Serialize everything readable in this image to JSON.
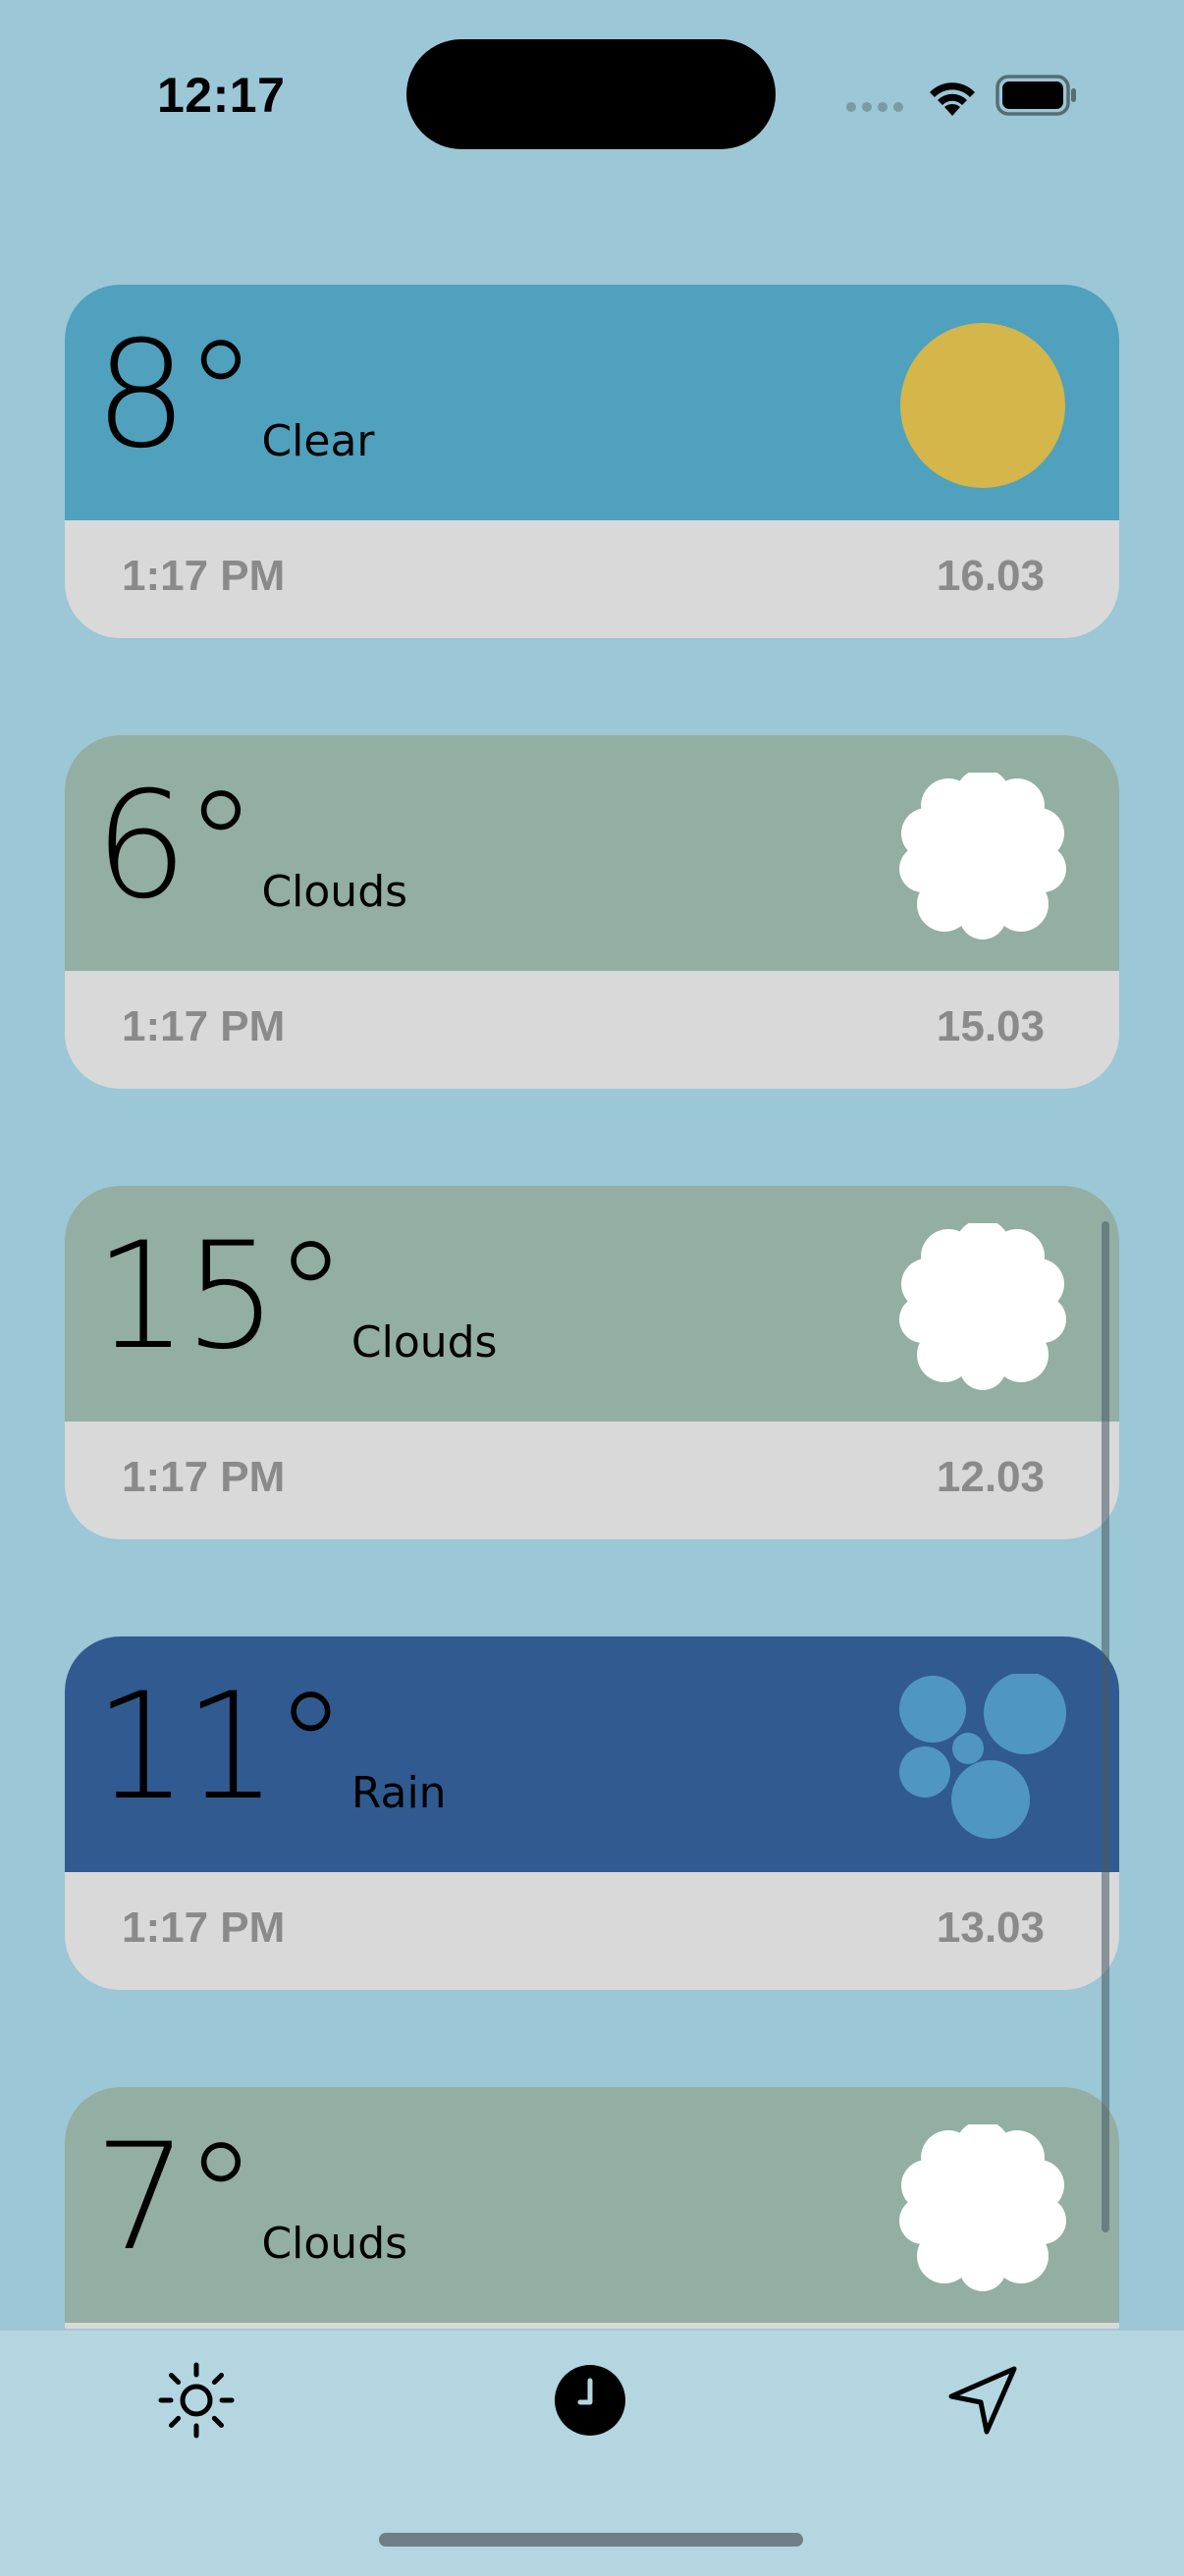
{
  "status_bar": {
    "time": "12:17"
  },
  "forecasts": [
    {
      "temp": "8",
      "degree": "°",
      "condition": "Clear",
      "time": "1:17 PM",
      "date": "16.03",
      "icon": "sun-icon",
      "color": "#4fa1bd"
    },
    {
      "temp": "6",
      "degree": "°",
      "condition": "Clouds",
      "time": "1:17 PM",
      "date": "15.03",
      "icon": "cloud-icon",
      "color": "#93aea3"
    },
    {
      "temp": "15",
      "degree": "°",
      "condition": "Clouds",
      "time": "1:17 PM",
      "date": "12.03",
      "icon": "cloud-icon",
      "color": "#93aea3"
    },
    {
      "temp": "11",
      "degree": "°",
      "condition": "Rain",
      "time": "1:17 PM",
      "date": "13.03",
      "icon": "rain-icon",
      "color": "#315a91"
    },
    {
      "temp": "7",
      "degree": "°",
      "condition": "Clouds",
      "time": "",
      "date": "",
      "icon": "cloud-icon",
      "color": "#93aea3"
    }
  ],
  "tab_bar": {
    "tabs": [
      {
        "name": "current-weather",
        "icon": "sun-icon",
        "active": false
      },
      {
        "name": "history",
        "icon": "clock-icon",
        "active": true
      },
      {
        "name": "location",
        "icon": "location-arrow-icon",
        "active": false
      }
    ]
  },
  "colors": {
    "background": "#9bc7d6",
    "tab_bar": "#b4d6e0",
    "card_footer": "#d9d9d9",
    "footer_text": "#8a8a8a",
    "sun": "#d4b64a",
    "cloud": "#ffffff",
    "rain_drop": "#4f97c2"
  }
}
